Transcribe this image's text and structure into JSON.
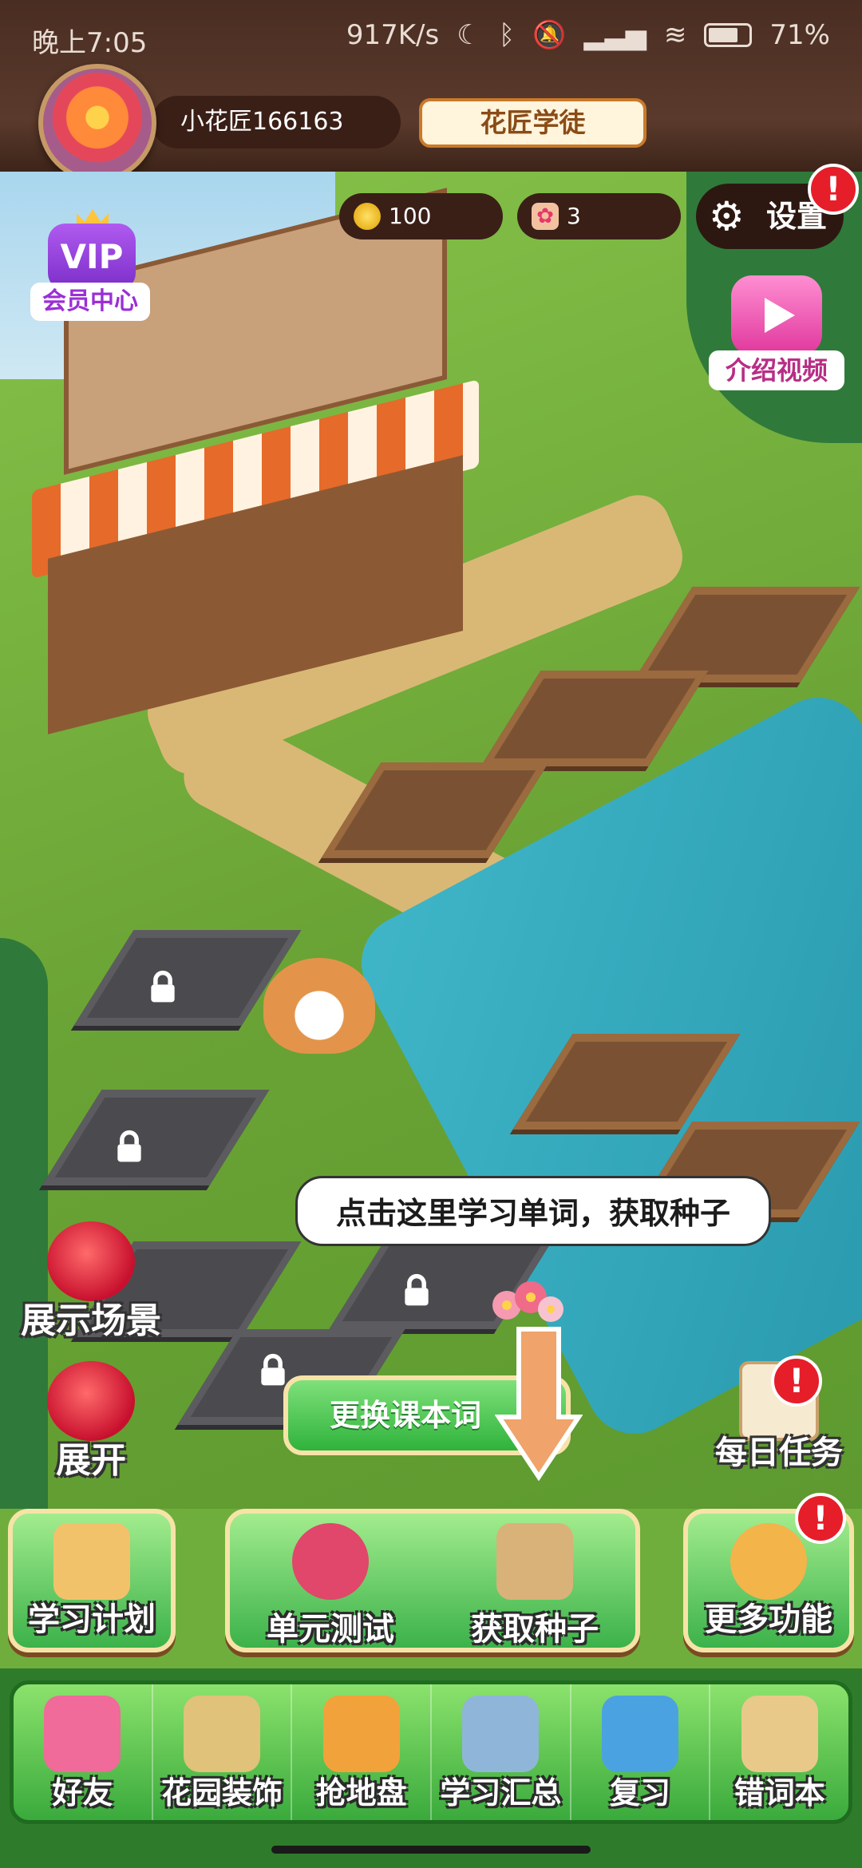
{
  "status_bar": {
    "time": "晚上7:05",
    "network_speed": "917K/s",
    "battery": "71%"
  },
  "header": {
    "username": "小花匠166163",
    "rank": "花匠学徒"
  },
  "resources": {
    "coins": "100",
    "flowers": "3"
  },
  "settings": {
    "label": "设置",
    "badge": "!"
  },
  "vip": {
    "badge": "VIP",
    "label": "会员中心"
  },
  "intro_video": {
    "label": "介绍视频"
  },
  "tooltip": "点击这里学习单词，获取种子",
  "scene_buttons": {
    "show_scene": "展示场景",
    "expand": "展开",
    "change_textbook": "更换课本词",
    "daily_tasks": "每日任务",
    "daily_badge": "!"
  },
  "actions": {
    "study_plan": "学习计划",
    "unit_test": "单元测试",
    "get_seeds": "获取种子",
    "more": "更多功能",
    "more_badge": "!"
  },
  "nav": [
    {
      "label": "好友",
      "icon": "flower-icon",
      "color": "#f06a9a"
    },
    {
      "label": "花园装饰",
      "icon": "garden-map-icon",
      "color": "#e0c27a"
    },
    {
      "label": "抢地盘",
      "icon": "pk-icon",
      "color": "#f2a23a"
    },
    {
      "label": "学习汇总",
      "icon": "hourglass-icon",
      "color": "#8fb6d8"
    },
    {
      "label": "复习",
      "icon": "book-icon",
      "color": "#4aa3e0"
    },
    {
      "label": "错词本",
      "icon": "scroll-icon",
      "color": "#e8c98a"
    }
  ],
  "colors": {
    "header_bg": "#4a2d22",
    "button_green": "#3cb24a",
    "alert_red": "#e61e2a"
  }
}
